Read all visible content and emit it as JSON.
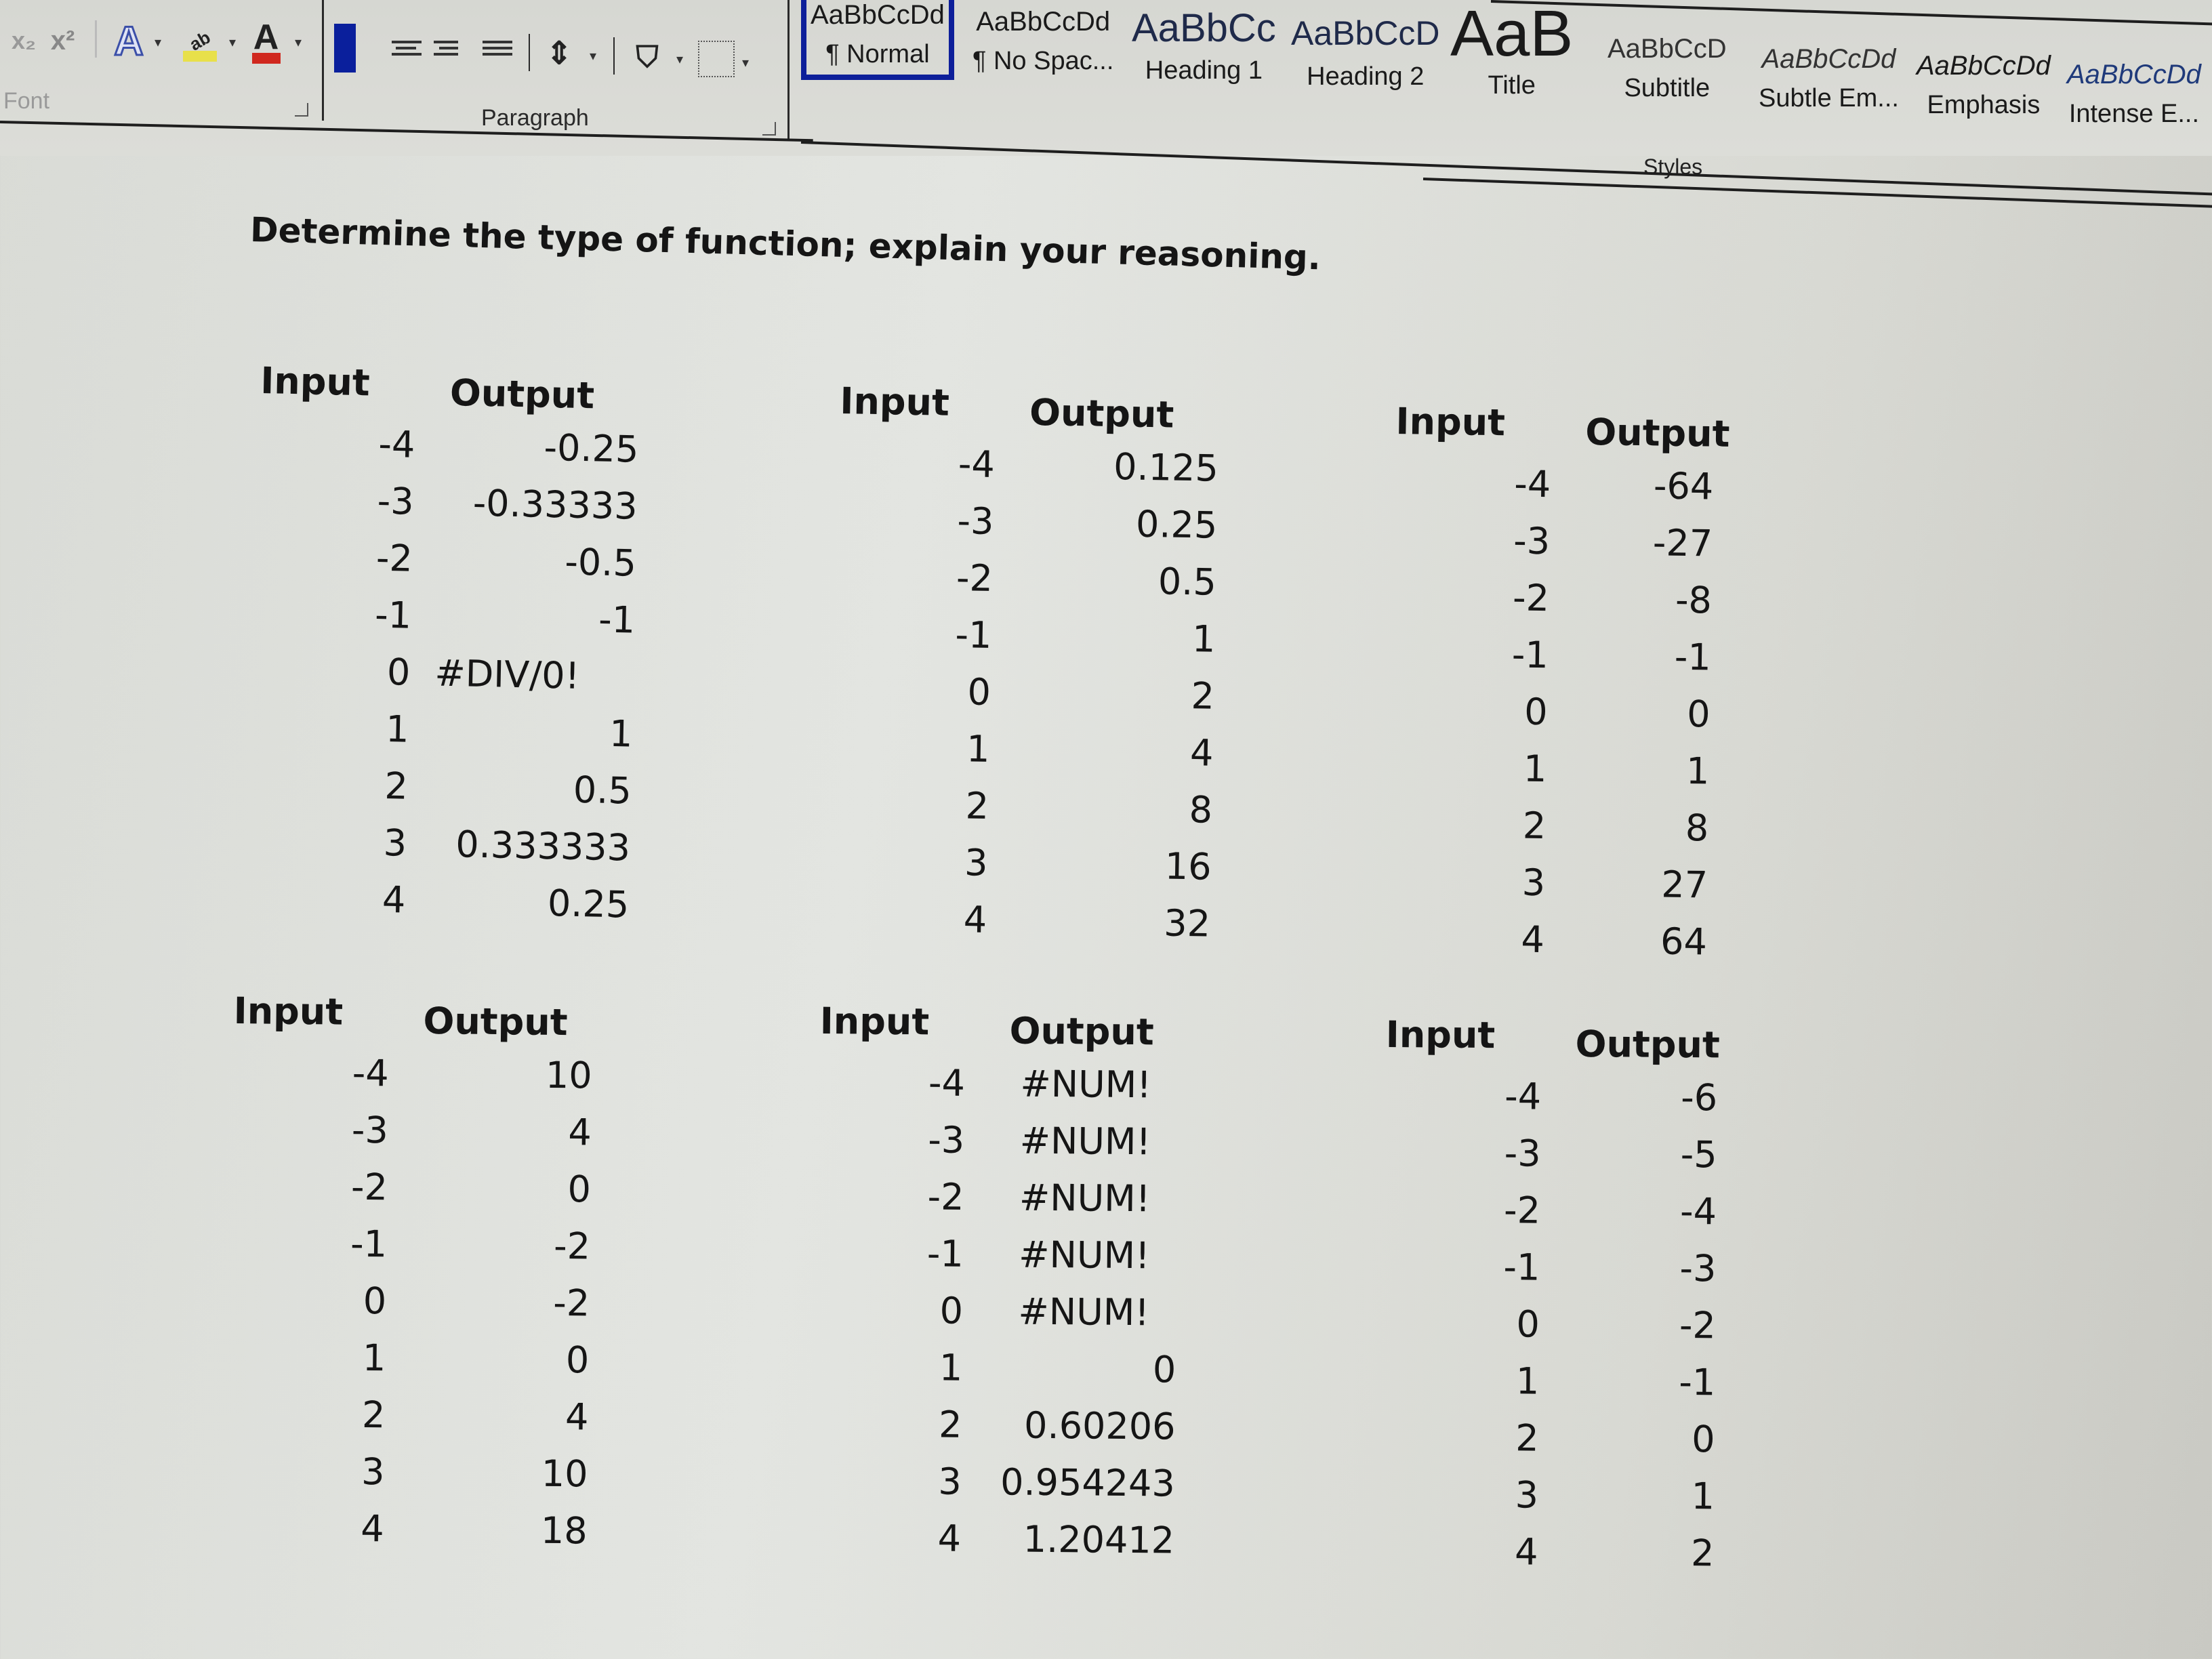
{
  "ribbon": {
    "font_group": {
      "label": "Font",
      "buttons": [
        {
          "name": "subscript",
          "glyph": "x₂"
        },
        {
          "name": "superscript",
          "glyph": "x²"
        },
        {
          "name": "text-effects",
          "glyph": "A"
        },
        {
          "name": "highlight-color",
          "glyph": "ab"
        },
        {
          "name": "font-color",
          "glyph": "A"
        }
      ],
      "highlight_color": "#e8e04a",
      "font_color": "#d0281e"
    },
    "paragraph_group": {
      "label": "Paragraph",
      "selected_alignment": "align-left",
      "selected_color": "#0a1f9c",
      "alignments": [
        "align-left",
        "align-center",
        "align-right",
        "justify"
      ]
    },
    "styles_group": {
      "label": "Styles",
      "items": [
        {
          "preview": "AaBbCcDd",
          "name": "¶ Normal",
          "selected": true
        },
        {
          "preview": "AaBbCcDd",
          "name": "¶ No Spac..."
        },
        {
          "preview": "AaBbCc",
          "name": "Heading 1"
        },
        {
          "preview": "AaBbCcD",
          "name": "Heading 2"
        },
        {
          "preview": "AaB",
          "name": "Title"
        },
        {
          "preview": "AaBbCcD",
          "name": "Subtitle"
        },
        {
          "preview": "AaBbCcDd",
          "name": "Subtle Em..."
        },
        {
          "preview": "AaBbCcDd",
          "name": "Emphasis"
        },
        {
          "preview": "AaBbCcDd",
          "name": "Intense E..."
        }
      ]
    }
  },
  "document": {
    "instruction": "Determine the type of function; explain your reasoning.",
    "tables": [
      {
        "input_header": "Input",
        "output_header": "Output",
        "rows": [
          [
            "-4",
            "-0.25"
          ],
          [
            "-3",
            "-0.33333"
          ],
          [
            "-2",
            "-0.5"
          ],
          [
            "-1",
            "-1"
          ],
          [
            "0",
            "#DIV/0!"
          ],
          [
            "1",
            "1"
          ],
          [
            "2",
            "0.5"
          ],
          [
            "3",
            "0.333333"
          ],
          [
            "4",
            "0.25"
          ]
        ]
      },
      {
        "input_header": "Input",
        "output_header": "Output",
        "rows": [
          [
            "-4",
            "0.125"
          ],
          [
            "-3",
            "0.25"
          ],
          [
            "-2",
            "0.5"
          ],
          [
            "-1",
            "1"
          ],
          [
            "0",
            "2"
          ],
          [
            "1",
            "4"
          ],
          [
            "2",
            "8"
          ],
          [
            "3",
            "16"
          ],
          [
            "4",
            "32"
          ]
        ]
      },
      {
        "input_header": "Input",
        "output_header": "Output",
        "rows": [
          [
            "-4",
            "-64"
          ],
          [
            "-3",
            "-27"
          ],
          [
            "-2",
            "-8"
          ],
          [
            "-1",
            "-1"
          ],
          [
            "0",
            "0"
          ],
          [
            "1",
            "1"
          ],
          [
            "2",
            "8"
          ],
          [
            "3",
            "27"
          ],
          [
            "4",
            "64"
          ]
        ]
      },
      {
        "input_header": "Input",
        "output_header": "Output",
        "rows": [
          [
            "-4",
            "10"
          ],
          [
            "-3",
            "4"
          ],
          [
            "-2",
            "0"
          ],
          [
            "-1",
            "-2"
          ],
          [
            "0",
            "-2"
          ],
          [
            "1",
            "0"
          ],
          [
            "2",
            "4"
          ],
          [
            "3",
            "10"
          ],
          [
            "4",
            "18"
          ]
        ]
      },
      {
        "input_header": "Input",
        "output_header": "Output",
        "rows": [
          [
            "-4",
            "#NUM!"
          ],
          [
            "-3",
            "#NUM!"
          ],
          [
            "-2",
            "#NUM!"
          ],
          [
            "-1",
            "#NUM!"
          ],
          [
            "0",
            "#NUM!"
          ],
          [
            "1",
            "0"
          ],
          [
            "2",
            "0.60206"
          ],
          [
            "3",
            "0.954243"
          ],
          [
            "4",
            "1.20412"
          ]
        ]
      },
      {
        "input_header": "Input",
        "output_header": "Output",
        "rows": [
          [
            "-4",
            "-6"
          ],
          [
            "-3",
            "-5"
          ],
          [
            "-2",
            "-4"
          ],
          [
            "-1",
            "-3"
          ],
          [
            "0",
            "-2"
          ],
          [
            "1",
            "-1"
          ],
          [
            "2",
            "0"
          ],
          [
            "3",
            "1"
          ],
          [
            "4",
            "2"
          ]
        ]
      }
    ]
  }
}
